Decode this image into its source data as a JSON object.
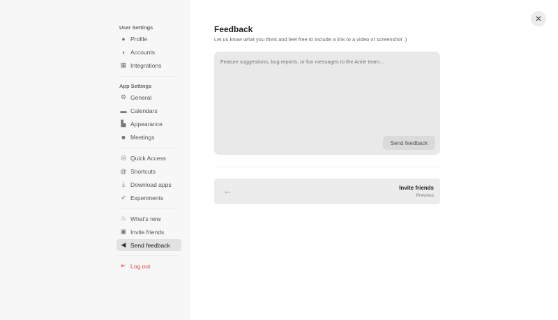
{
  "sidebar": {
    "user_settings": "User Settings",
    "app_settings": "App Settings",
    "items": [
      {
        "label": "Profile",
        "icon": "user-circle-icon"
      },
      {
        "label": "Accounts",
        "icon": "toggle-icon"
      },
      {
        "label": "Integrations",
        "icon": "grid-icon"
      },
      {
        "label": "General",
        "icon": "gear-icon"
      },
      {
        "label": "Calendars",
        "icon": "calendar-icon"
      },
      {
        "label": "Appearance",
        "icon": "palette-icon"
      },
      {
        "label": "Meetings",
        "icon": "video-icon"
      },
      {
        "label": "Quick Access",
        "icon": "target-icon"
      },
      {
        "label": "Shortcuts",
        "icon": "at-icon"
      },
      {
        "label": "Download apps",
        "icon": "download-icon"
      },
      {
        "label": "Experiments",
        "icon": "rocket-icon"
      },
      {
        "label": "What's new",
        "icon": "flame-icon"
      },
      {
        "label": "Invite friends",
        "icon": "gift-icon"
      },
      {
        "label": "Send feedback",
        "icon": "megaphone-icon"
      },
      {
        "label": "Log out",
        "icon": "logout-icon"
      }
    ]
  },
  "main": {
    "title": "Feedback",
    "subtitle": "Let us know what you think and feel free to include a link to a video or screenshot :)",
    "placeholder": "Feature suggestions, bug reports, or fun messages to the Amie team...",
    "send_label": "Send feedback",
    "prev_title": "Invite friends",
    "prev_label": "Previous"
  },
  "colors": {
    "logout": "#e5484d",
    "sidebar_bg": "#f7f7f7"
  }
}
